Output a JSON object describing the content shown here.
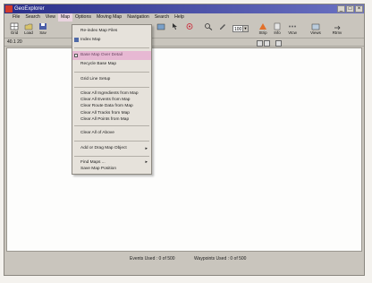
{
  "window": {
    "title": "GeoExplorer"
  },
  "menubar": [
    "File",
    "Search",
    "View",
    "Map",
    "Options",
    "Moving Map",
    "Navigation",
    "Search",
    "Help"
  ],
  "toolbar": {
    "buttons": [
      "Grid",
      "Load",
      "Sav",
      "",
      "",
      "",
      "Strip",
      "Info",
      "Vtcw",
      "Find",
      "Views",
      "Rtrnv"
    ],
    "zoom_value": "100"
  },
  "status_row": {
    "coord": "40.1 20"
  },
  "map_menu": {
    "items": [
      {
        "label": "Re-index Map Files"
      },
      {
        "label": "Index Map"
      },
      {
        "label": "Base Map Over Detail",
        "highlight": true,
        "checkbox": true
      },
      {
        "label": "Recycle Base Map"
      },
      {
        "label": "Grid Line Setup"
      },
      {
        "label": "Clear All Ingredients from Map"
      },
      {
        "label": "Clear All Events from Map"
      },
      {
        "label": "Clear Route Data from Map"
      },
      {
        "label": "Clear All Tracks from Map"
      },
      {
        "label": "Clear All Points from Map"
      },
      {
        "label": "Clear All of Above"
      },
      {
        "label": "Add or Drag Map Object",
        "submenu": true
      },
      {
        "label": "Find Maps ...",
        "submenu": true
      },
      {
        "label": "Save Map Position"
      }
    ]
  },
  "statusbar": {
    "events": "Events Used : 0 of 500",
    "waypoints": "Waypoints Used : 0 of 500"
  }
}
